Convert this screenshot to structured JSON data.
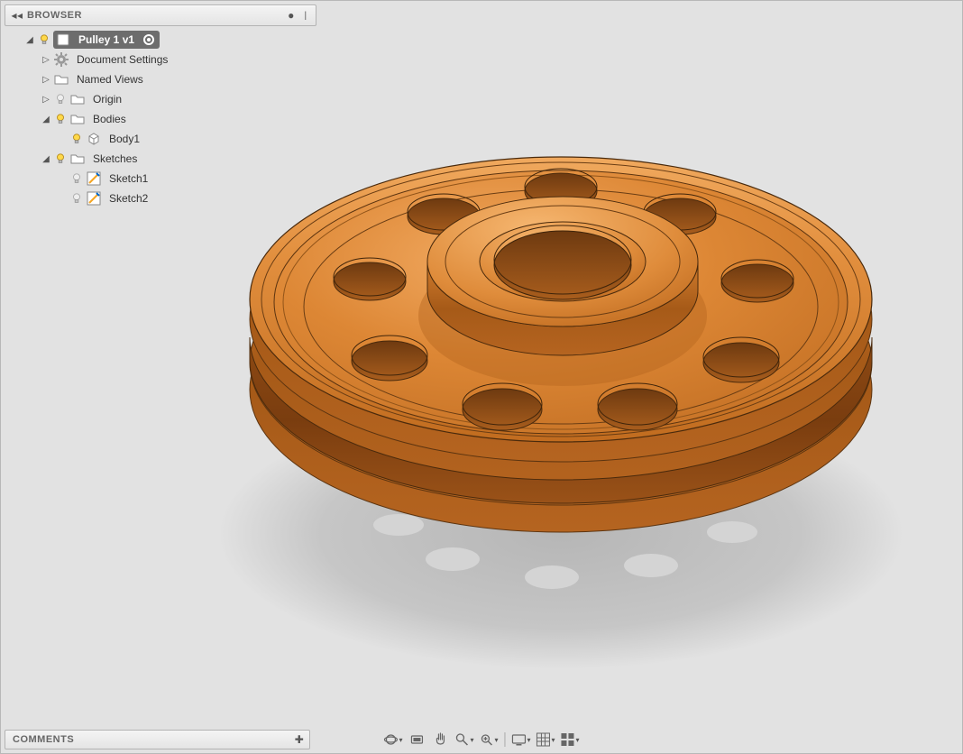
{
  "browser": {
    "title": "BROWSER",
    "root": {
      "label": "Pulley 1 v1",
      "children": [
        {
          "label": "Document Settings"
        },
        {
          "label": "Named Views"
        },
        {
          "label": "Origin"
        },
        {
          "label": "Bodies",
          "children": [
            {
              "label": "Body1"
            }
          ]
        },
        {
          "label": "Sketches",
          "children": [
            {
              "label": "Sketch1"
            },
            {
              "label": "Sketch2"
            }
          ]
        }
      ]
    }
  },
  "comments": {
    "title": "COMMENTS"
  },
  "navbar": {
    "items": [
      "orbit",
      "look-at",
      "pan",
      "zoom",
      "fit",
      "display-settings",
      "grid-settings",
      "viewports"
    ]
  },
  "model": {
    "name": "Pulley",
    "color": "#d97f2f",
    "shadowColor": "#bcbcbc"
  }
}
